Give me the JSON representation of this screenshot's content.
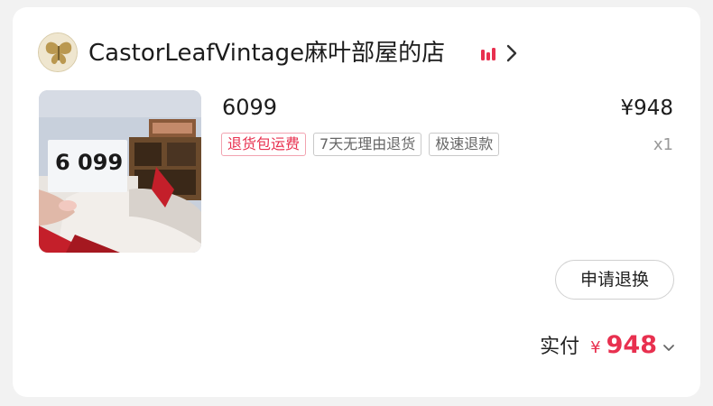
{
  "shop": {
    "name": "CastorLeafVintage麻叶部屋的店",
    "avatar_icon": "butterfly-logo-icon",
    "live_icon": "live-bars-icon",
    "accent_color": "#e8304f"
  },
  "product": {
    "title": "6099",
    "price": "¥948",
    "quantity": "x1",
    "image_label": "6 099",
    "tags": [
      "退货包运费",
      "7天无理由退货",
      "极速退款"
    ]
  },
  "actions": {
    "refund_label": "申请退换"
  },
  "payment": {
    "label": "实付",
    "currency": "¥",
    "amount": "948"
  }
}
